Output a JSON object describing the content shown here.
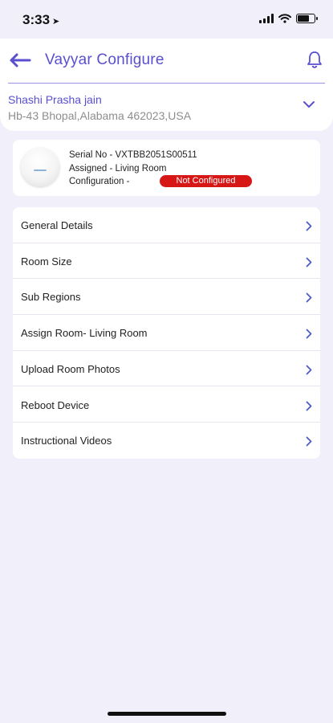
{
  "status_bar": {
    "time": "3:33",
    "location_glyph": "➤"
  },
  "header": {
    "title": "Vayyar Configure",
    "user_name": "Shashi Prasha jain",
    "user_address": "Hb-43  Bhopal,Alabama 462023,USA"
  },
  "device": {
    "serial_line": "Serial No -  VXTBB2051S00511",
    "assigned_line": "Assigned - Living Room",
    "configuration_label": "Configuration -",
    "status_badge": "Not Configured"
  },
  "menu": {
    "items": [
      {
        "label": "General Details"
      },
      {
        "label": "Room Size"
      },
      {
        "label": "Sub Regions"
      },
      {
        "label": "Assign Room- Living Room"
      },
      {
        "label": "Upload Room Photos"
      },
      {
        "label": "Reboot Device"
      },
      {
        "label": "Instructional Videos"
      }
    ]
  },
  "colors": {
    "accent": "#5b4fd1",
    "background": "#f1eff9",
    "badge_red": "#d71616",
    "chevron": "#4d5bc9"
  },
  "icons": [
    "back-arrow-icon",
    "bell-icon",
    "chevron-down-icon",
    "chevron-right-icon",
    "wifi-icon",
    "battery-icon",
    "signal-icon"
  ]
}
